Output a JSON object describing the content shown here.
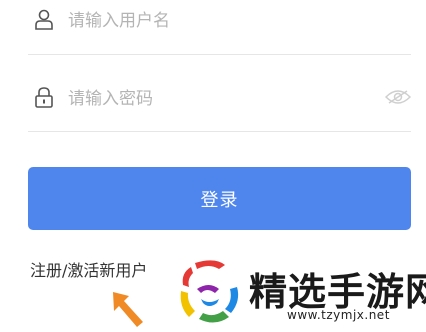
{
  "form": {
    "username_placeholder": "请输入用户名",
    "username_value": "",
    "password_placeholder": "请输入密码",
    "password_value": "",
    "login_label": "登录",
    "register_label": "注册/激活新用户"
  },
  "icons": {
    "username": "user-icon",
    "password": "lock-icon",
    "toggle": "eye-icon"
  },
  "watermark": {
    "title": "精选手游网",
    "url": "www.tzymjx.net"
  },
  "colors": {
    "primary": "#4f86ee",
    "placeholder": "#b4b4b4",
    "arrow": "#f08a24"
  }
}
